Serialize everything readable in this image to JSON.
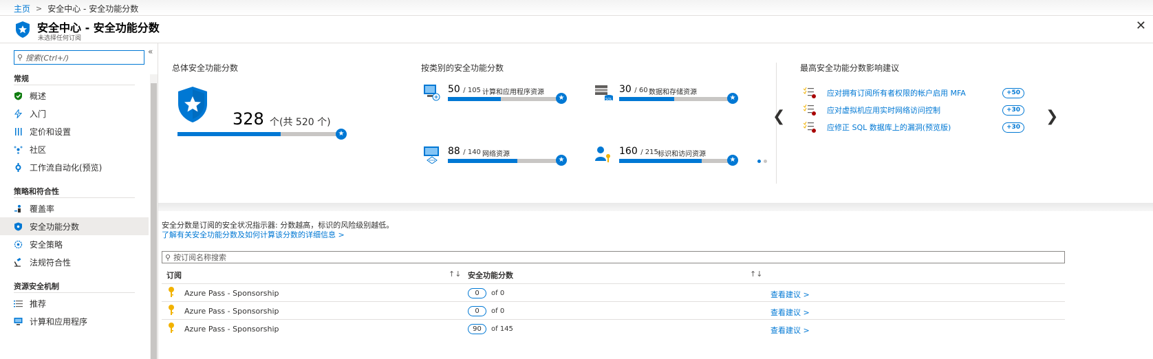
{
  "breadcrumb": {
    "home": "主页",
    "separator": ">",
    "current": "安全中心 - 安全功能分数"
  },
  "header": {
    "title": "安全中心 - 安全功能分数",
    "subtitle": "未选择任何订阅",
    "close": "✕"
  },
  "sidebar": {
    "search_placeholder": "搜索(Ctrl+/)",
    "collapse": "«",
    "sections": [
      {
        "title": "常规",
        "items": [
          {
            "label": "概述",
            "icon": "shield-check-icon"
          },
          {
            "label": "入门",
            "icon": "bolt-icon"
          },
          {
            "label": "定价和设置",
            "icon": "sliders-icon"
          },
          {
            "label": "社区",
            "icon": "community-icon"
          },
          {
            "label": "工作流自动化(预览)",
            "icon": "workflow-icon"
          }
        ]
      },
      {
        "title": "策略和符合性",
        "items": [
          {
            "label": "覆盖率",
            "icon": "coverage-icon"
          },
          {
            "label": "安全功能分数",
            "icon": "shield-icon",
            "active": true
          },
          {
            "label": "安全策略",
            "icon": "policy-icon"
          },
          {
            "label": "法规符合性",
            "icon": "gavel-icon"
          }
        ]
      },
      {
        "title": "资源安全机制",
        "items": [
          {
            "label": "推荐",
            "icon": "list-icon"
          },
          {
            "label": "计算和应用程序",
            "icon": "compute-icon"
          }
        ]
      }
    ]
  },
  "overall": {
    "title": "总体安全功能分数",
    "score": "328",
    "of_text": "个(共 520 个)",
    "fraction": 0.63
  },
  "category": {
    "title": "按类别的安全功能分数",
    "items": [
      {
        "score": "50",
        "max": "/ 105",
        "name": "计算和应用程序资源",
        "fraction": 0.48,
        "icon": "compute-icon"
      },
      {
        "score": "30",
        "max": "/ 60",
        "name": "数据和存储资源",
        "fraction": 0.5,
        "icon": "sql-icon"
      },
      {
        "score": "88",
        "max": "/ 140",
        "name": "网络资源",
        "fraction": 0.63,
        "icon": "network-icon"
      },
      {
        "score": "160",
        "max": "/ 215",
        "name": "标识和访问资源",
        "fraction": 0.75,
        "icon": "identity-icon"
      }
    ]
  },
  "recommendations": {
    "title": "最高安全功能分数影响建议",
    "items": [
      {
        "label": "应对拥有订阅所有者权限的帐户启用 MFA",
        "impact": "+50"
      },
      {
        "label": "应对虚拟机应用实时网络访问控制",
        "impact": "+30"
      },
      {
        "label": "应修正 SQL 数据库上的漏洞(预览版)",
        "impact": "+30"
      }
    ],
    "prev": "❮",
    "next": "❯"
  },
  "info": {
    "description": "安全分数是订阅的安全状况指示器: 分数越高，标识的风险级别越低。",
    "learn_more": "了解有关安全功能分数及如何计算该分数的详细信息 >"
  },
  "table": {
    "search_placeholder": "按订阅名称搜索",
    "col_subscription": "订阅",
    "col_score": "安全功能分数",
    "sort_icon": "↑↓",
    "rows": [
      {
        "name": "Azure Pass - Sponsorship",
        "score": "0",
        "of": "of 0",
        "action": "查看建议 >"
      },
      {
        "name": "Azure Pass - Sponsorship",
        "score": "0",
        "of": "of 0",
        "action": "查看建议 >"
      },
      {
        "name": "Azure Pass - Sponsorship",
        "score": "90",
        "of": "of 145",
        "action": "查看建议 >"
      }
    ]
  },
  "colors": {
    "accent": "#0078d4",
    "bar_bg": "#c8c6c4",
    "key_gold": "#f2b200"
  }
}
